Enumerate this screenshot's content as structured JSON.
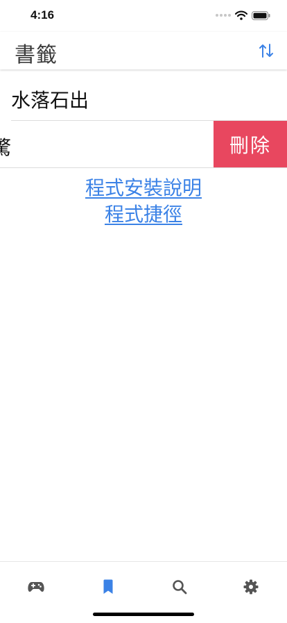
{
  "status_bar": {
    "time": "4:16"
  },
  "header": {
    "title": "書籤"
  },
  "bookmarks": [
    {
      "label": "水落石出"
    },
    {
      "label": "驚"
    }
  ],
  "row_actions": {
    "delete_label": "刪除"
  },
  "links": [
    {
      "label": "程式安裝說明"
    },
    {
      "label": "程式捷徑"
    }
  ],
  "tab_bar": {
    "tabs": [
      {
        "icon": "gamepad-icon",
        "active": false
      },
      {
        "icon": "bookmark-icon",
        "active": true
      },
      {
        "icon": "search-icon",
        "active": false
      },
      {
        "icon": "gear-icon",
        "active": false
      }
    ]
  },
  "colors": {
    "accent": "#3b82e6",
    "delete": "#e8475f",
    "inactive_icon": "#555555"
  }
}
